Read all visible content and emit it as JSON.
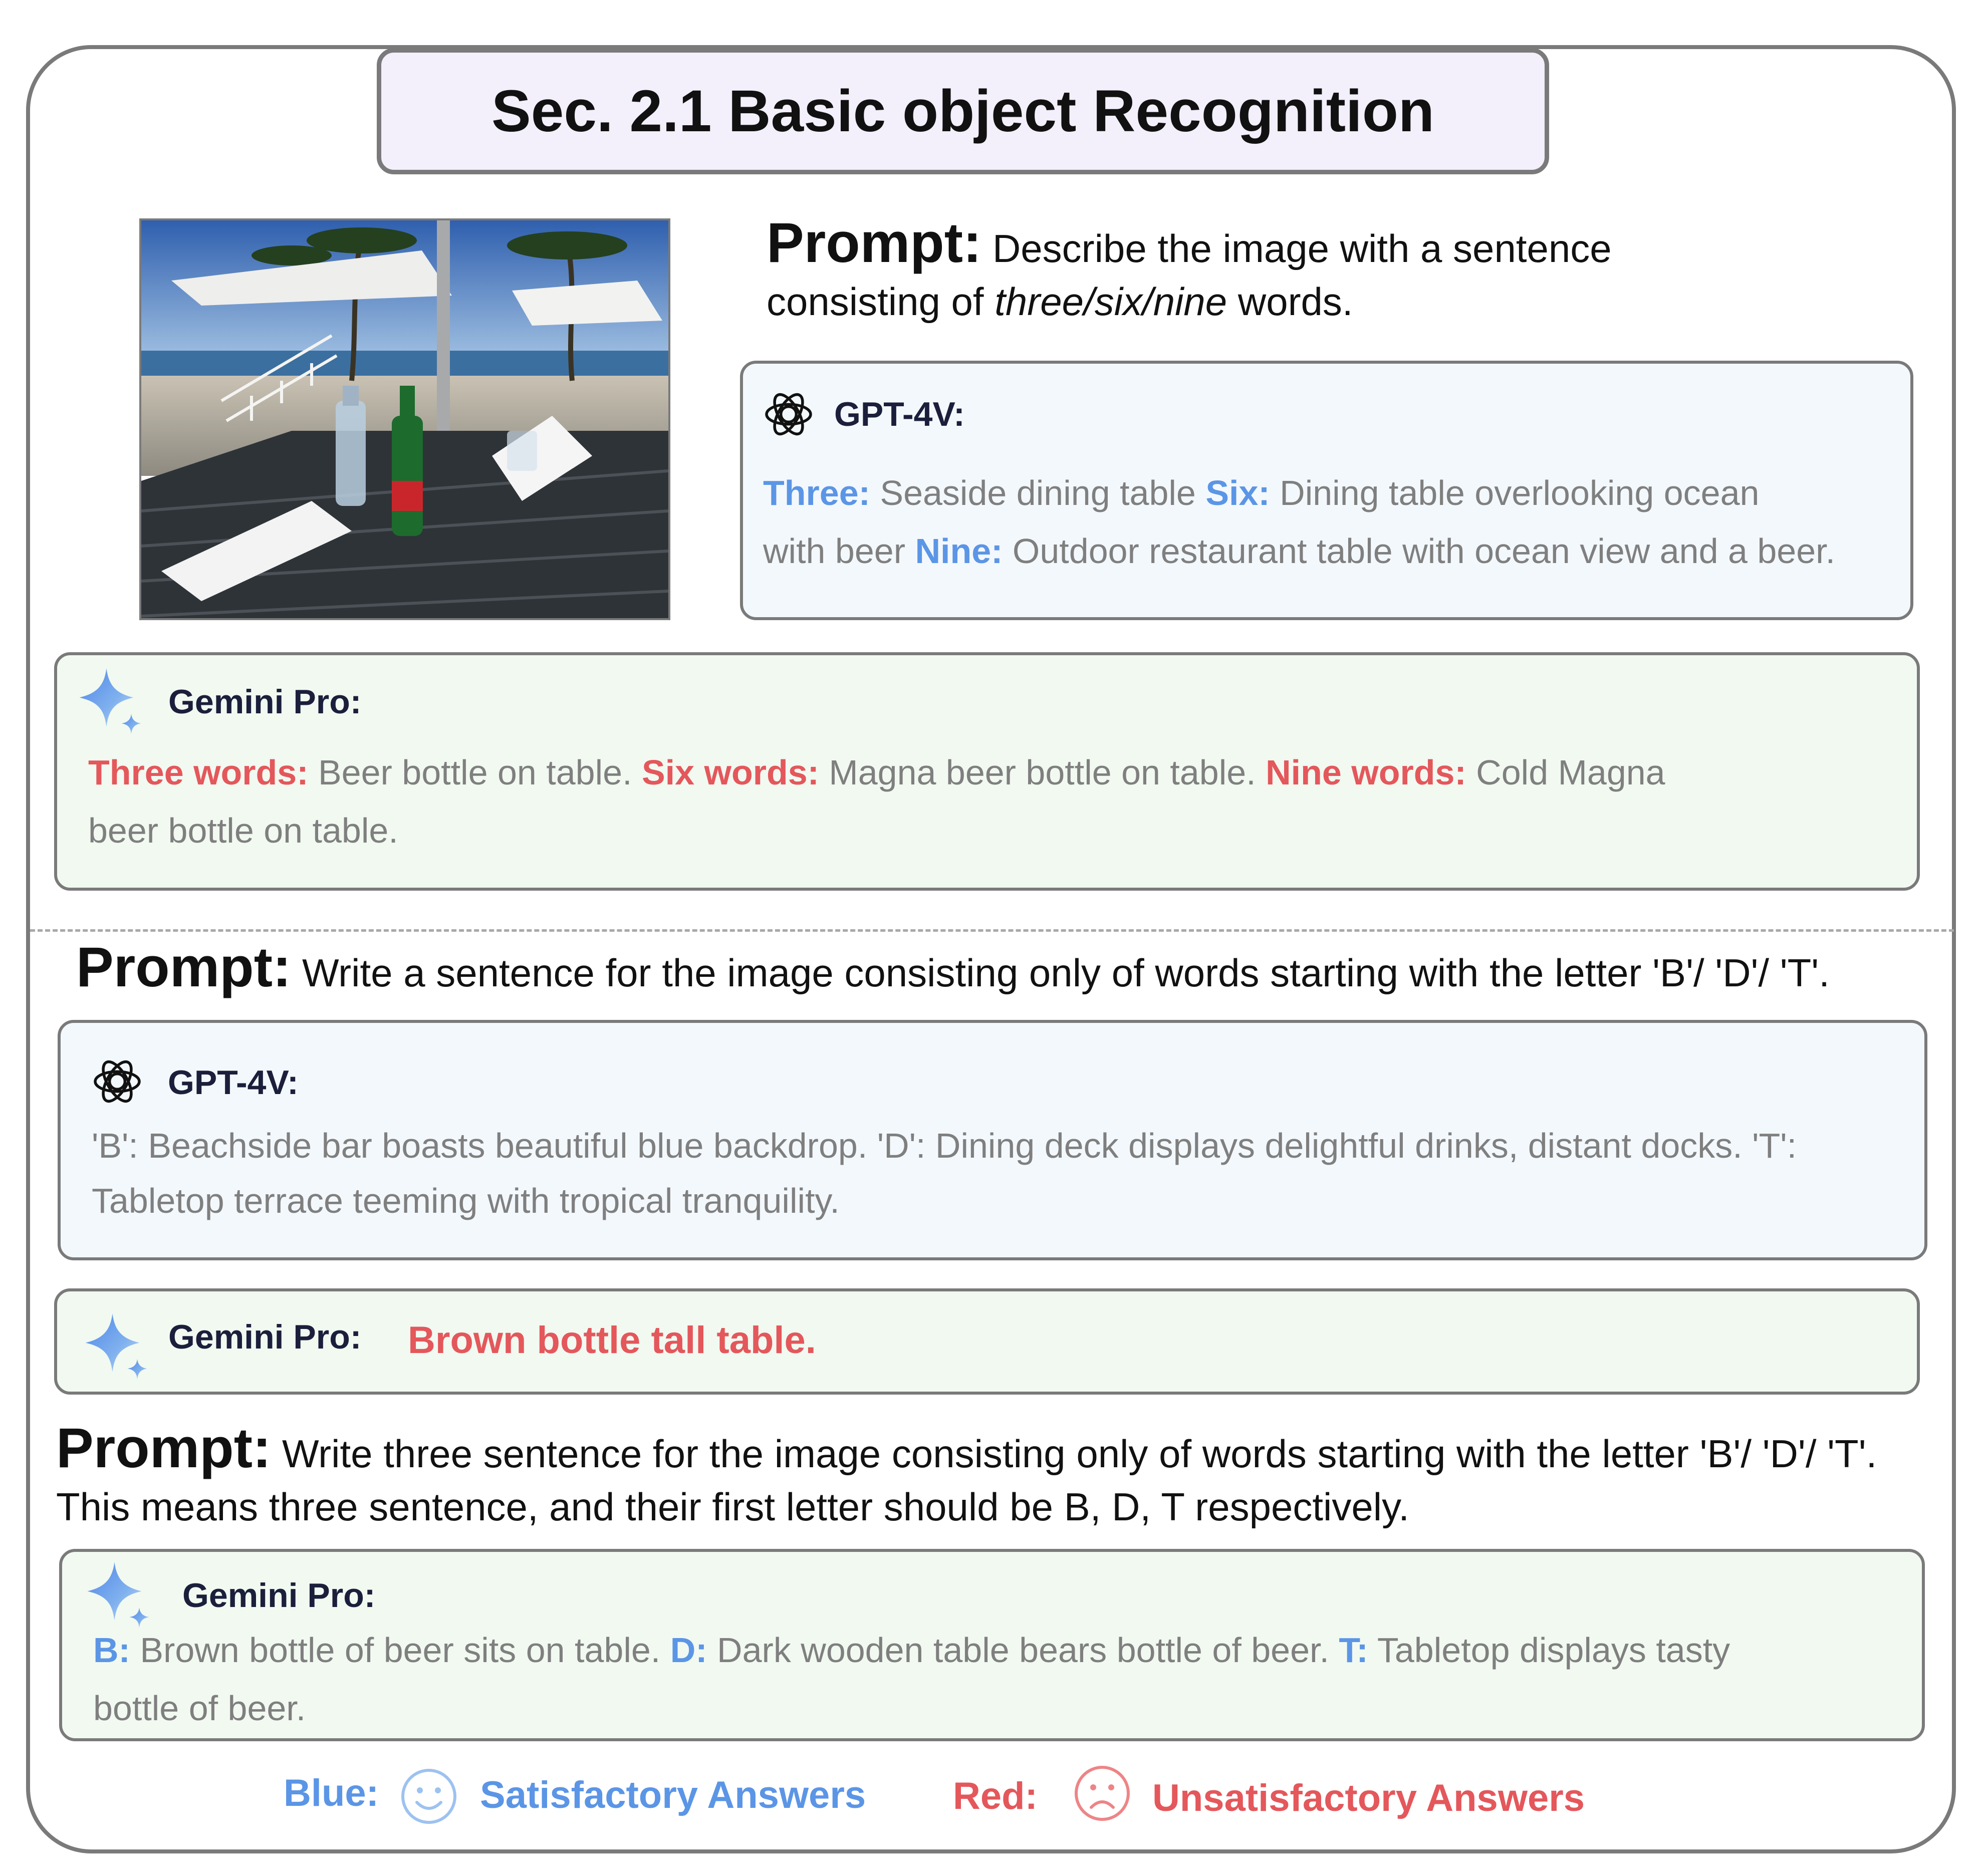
{
  "title": "Sec. 2.1 Basic object Recognition",
  "section1": {
    "prompt_label": "Prompt:",
    "prompt_text_a": " Describe the image with a sentence",
    "prompt_text_b": "consisting of ",
    "prompt_text_italic": "three/six/nine",
    "prompt_text_c": " words.",
    "gpt": {
      "model": "GPT-4V:",
      "k1": "Three:",
      "v1": " Seaside dining table ",
      "k2": "Six:",
      "v2": " Dining table overlooking ocean",
      "v2b": "with beer ",
      "k3": "Nine:",
      "v3": " Outdoor restaurant table with ocean view and a beer."
    },
    "gemini": {
      "model": "Gemini Pro:",
      "k1": "Three words:",
      "v1": " Beer bottle on table. ",
      "k2": "Six words:",
      "v2": " Magna beer bottle on table. ",
      "k3": "Nine words:",
      "v3": " Cold Magna",
      "v3b": "beer bottle on table."
    }
  },
  "section2": {
    "prompt_label": "Prompt:",
    "prompt_text": " Write a sentence for the image consisting only of words starting with the letter 'B'/ 'D'/ 'T'.",
    "gpt": {
      "model": "GPT-4V:",
      "line1": "'B': Beachside bar boasts beautiful blue backdrop. 'D': Dining deck displays delightful drinks, distant docks. 'T':",
      "line2": "Tabletop terrace teeming with tropical tranquility."
    },
    "gemini": {
      "model": "Gemini Pro:",
      "answer": "Brown bottle tall table."
    }
  },
  "section3": {
    "prompt_label": "Prompt:",
    "prompt_text_a": " Write three sentence for the image consisting only of words starting with the letter 'B'/ 'D'/ 'T'.",
    "prompt_text_b": "This means three sentence, and their first letter should be B, D, T respectively.",
    "gemini": {
      "model": "Gemini Pro:",
      "k1": "B:",
      "v1": " Brown bottle of beer sits on table. ",
      "k2": "D:",
      "v2": " Dark wooden table bears bottle of beer. ",
      "k3": "T:",
      "v3": " Tabletop displays tasty",
      "v3b": "bottle of beer."
    }
  },
  "legend": {
    "blue_key": "Blue:",
    "blue_text": "Satisfactory Answers",
    "red_key": "Red:",
    "red_text": "Unsatisfactory Answers"
  },
  "icons": {
    "gpt": "openai-logo-icon",
    "gemini": "gemini-sparkle-icon",
    "satisfied": "smiley-face-icon",
    "unsatisfied": "frowny-face-icon"
  },
  "colors": {
    "satisfactory": "#5b95e6",
    "unsatisfactory": "#e4575b",
    "gpt_box": "#f3f8fc",
    "gemini_box": "#f1f9f1",
    "title_box": "#f3effb"
  }
}
